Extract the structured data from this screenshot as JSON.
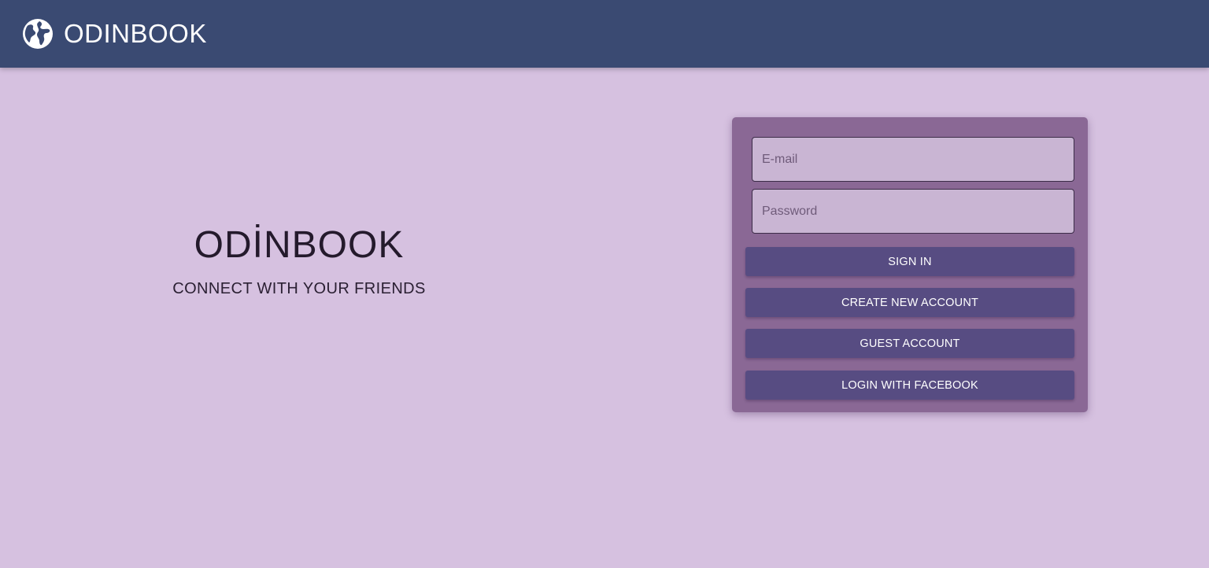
{
  "header": {
    "icon": "globe-icon",
    "brand": "ODINBOOK",
    "bg_color": "#3a4a72"
  },
  "hero": {
    "title": "ODİNBOOK",
    "subtitle": "CONNECT WITH YOUR FRIENDS"
  },
  "login": {
    "email_placeholder": "E-mail",
    "password_placeholder": "Password",
    "sign_in_label": "SIGN IN",
    "create_account_label": "CREATE NEW ACCOUNT",
    "guest_account_label": "GUEST ACCOUNT",
    "facebook_label": "LOGIN WITH FACEBOOK",
    "card_color": "#8a6895",
    "button_color": "#574c82"
  },
  "page": {
    "background_color": "#d6c1e0"
  }
}
